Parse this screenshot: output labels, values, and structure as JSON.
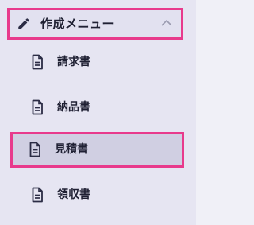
{
  "menu": {
    "group": {
      "label": "作成メニュー",
      "icon": "pencil-icon",
      "toggle_icon": "chevron-up-icon",
      "expanded": true
    },
    "items": [
      {
        "label": "請求書",
        "icon": "document-icon",
        "selected": false
      },
      {
        "label": "納品書",
        "icon": "document-icon",
        "selected": false
      },
      {
        "label": "見積書",
        "icon": "document-icon",
        "selected": true
      },
      {
        "label": "領収書",
        "icon": "document-icon",
        "selected": false
      }
    ]
  },
  "colors": {
    "highlight_border": "#e83a8c",
    "menu_background": "#e6e5f2",
    "selected_background": "#d0cfe2",
    "text": "#1f2033",
    "icon": "#2b2c45",
    "chevron": "#9b9bb0"
  }
}
